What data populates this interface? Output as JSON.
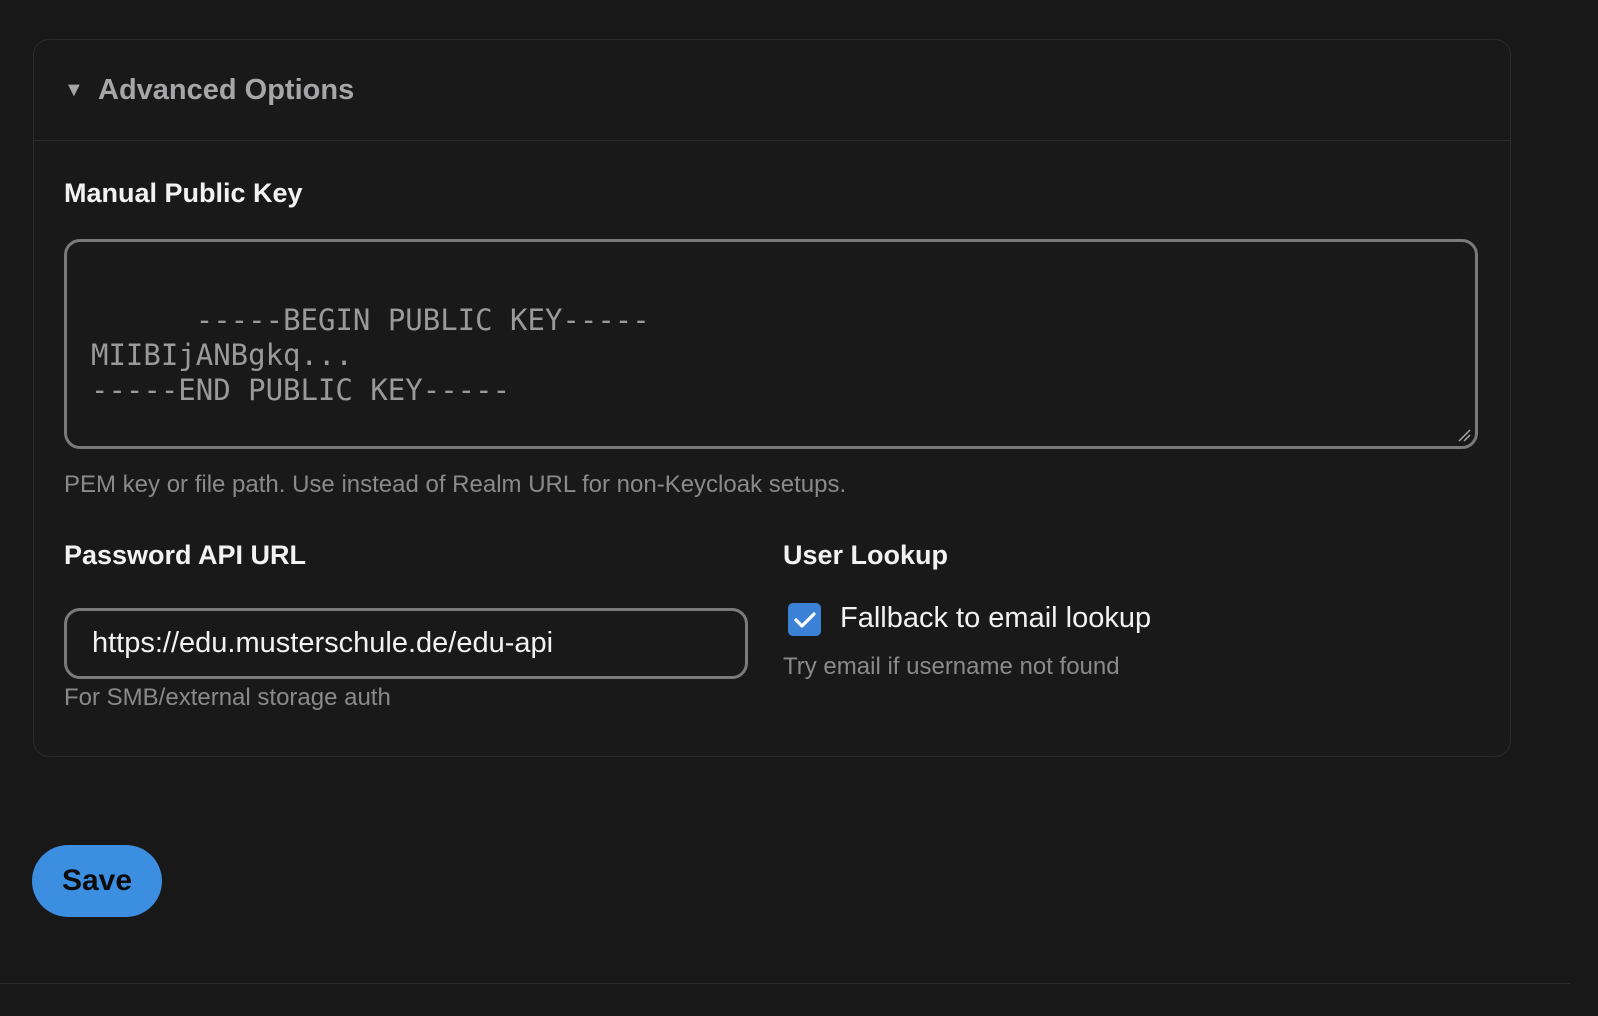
{
  "advanced": {
    "title": "Advanced Options",
    "caret_icon": "caret-down-icon"
  },
  "public_key": {
    "label": "Manual Public Key",
    "placeholder": "-----BEGIN PUBLIC KEY-----\nMIIBIjANBgkq...\n-----END PUBLIC KEY-----",
    "help": "PEM key or file path. Use instead of Realm URL for non-Keycloak setups."
  },
  "password_api": {
    "label": "Password API URL",
    "value": "https://edu.musterschule.de/edu-api",
    "help": "For SMB/external storage auth"
  },
  "user_lookup": {
    "label": "User Lookup",
    "checkbox_label": "Fallback to email lookup",
    "checked": true,
    "help": "Try email if username not found"
  },
  "save_label": "Save",
  "colors": {
    "accent": "#3b8ee0",
    "checkbox": "#3b82d6",
    "background": "#181819"
  }
}
